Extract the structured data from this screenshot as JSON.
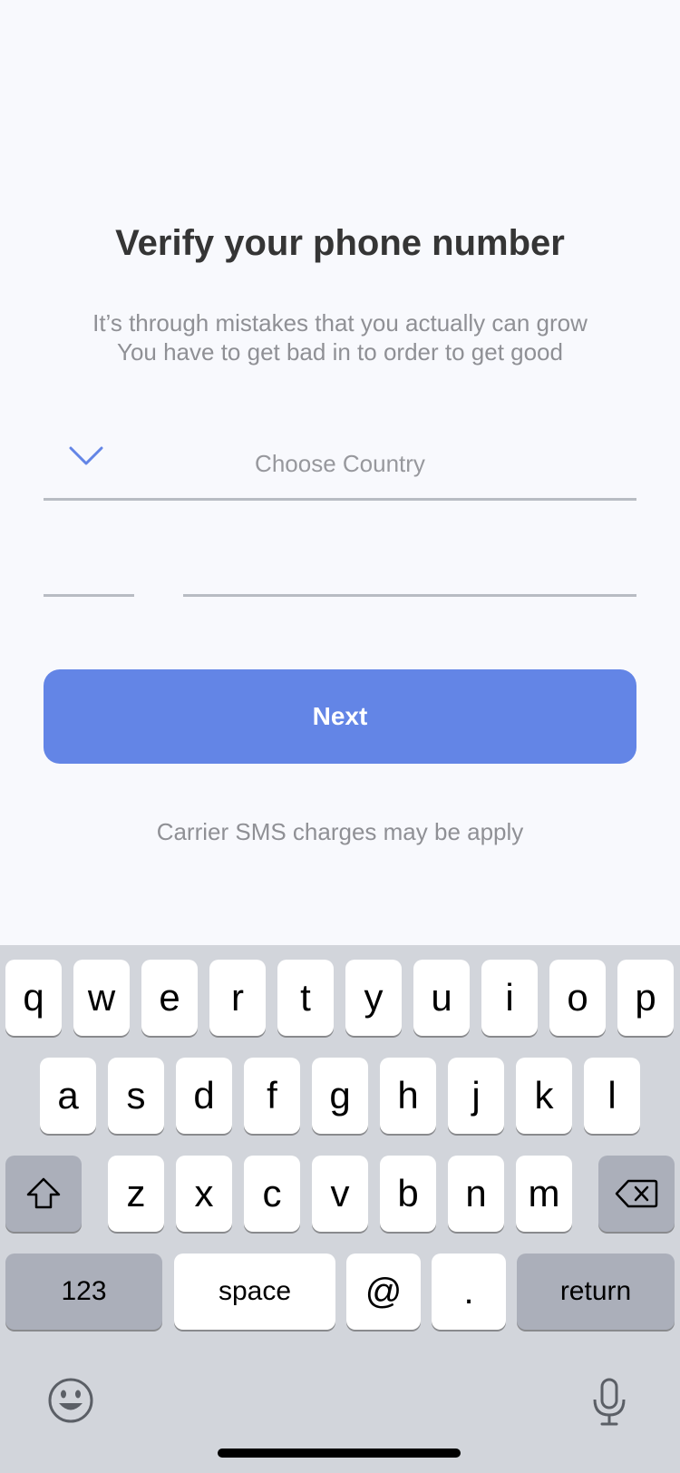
{
  "screen": {
    "title": "Verify your phone number",
    "subtitle_lines": [
      "It’s through mistakes that you actually can grow",
      "You have to get bad in to order to get good"
    ],
    "country_select": {
      "placeholder": "Choose Country",
      "icon": "chevron-down-icon"
    },
    "country_code_input": {
      "value": "",
      "placeholder": ""
    },
    "phone_input": {
      "value": "",
      "placeholder": ""
    },
    "next_button": "Next",
    "note": "Carrier SMS charges may be apply"
  },
  "keyboard": {
    "row1": [
      "q",
      "w",
      "e",
      "r",
      "t",
      "y",
      "u",
      "i",
      "o",
      "p"
    ],
    "row2": [
      "a",
      "s",
      "d",
      "f",
      "g",
      "h",
      "j",
      "k",
      "l"
    ],
    "row3": [
      "z",
      "x",
      "c",
      "v",
      "b",
      "n",
      "m"
    ],
    "shift_icon": "shift-icon",
    "delete_icon": "backspace-icon",
    "numbers_key": "123",
    "space_key": "space",
    "at_key": "@",
    "dot_key": ".",
    "return_key": "return",
    "emoji_icon": "emoji-icon",
    "mic_icon": "microphone-icon"
  },
  "colors": {
    "accent": "#6385e6",
    "background": "#f8f9fd",
    "keyboard": "#d2d5db"
  }
}
